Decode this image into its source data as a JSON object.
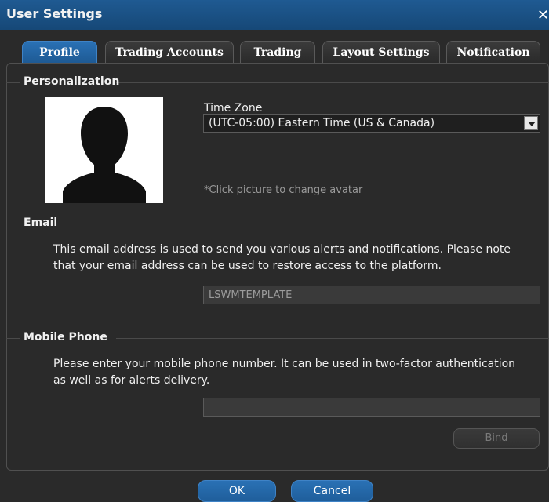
{
  "window": {
    "title": "User Settings",
    "close_glyph": "✕"
  },
  "tabs": [
    {
      "label": "Profile",
      "active": true
    },
    {
      "label": "Trading Accounts",
      "active": false
    },
    {
      "label": "Trading",
      "active": false
    },
    {
      "label": "Layout Settings",
      "active": false
    },
    {
      "label": "Notification",
      "active": false
    }
  ],
  "personalization": {
    "heading": "Personalization",
    "timezone_label": "Time Zone",
    "timezone_value": "(UTC-05:00) Eastern Time (US & Canada)",
    "avatar_hint": "*Click picture to change avatar"
  },
  "email": {
    "heading": "Email",
    "description_line1": "This email address is used to send you various alerts and notifications. Please note",
    "description_line2": "that your email address can be used to restore access to the platform.",
    "value": "LSWMTEMPLATE"
  },
  "mobile": {
    "heading": "Mobile Phone",
    "description_line1": "Please enter your mobile phone number. It can be used in two-factor authentication",
    "description_line2": "as well as for alerts delivery.",
    "value": "",
    "bind_label": "Bind"
  },
  "buttons": {
    "ok": "OK",
    "cancel": "Cancel"
  },
  "colors": {
    "titlebar": "#1a4f84",
    "accent": "#2a71b5",
    "background": "#2a2a2a"
  }
}
